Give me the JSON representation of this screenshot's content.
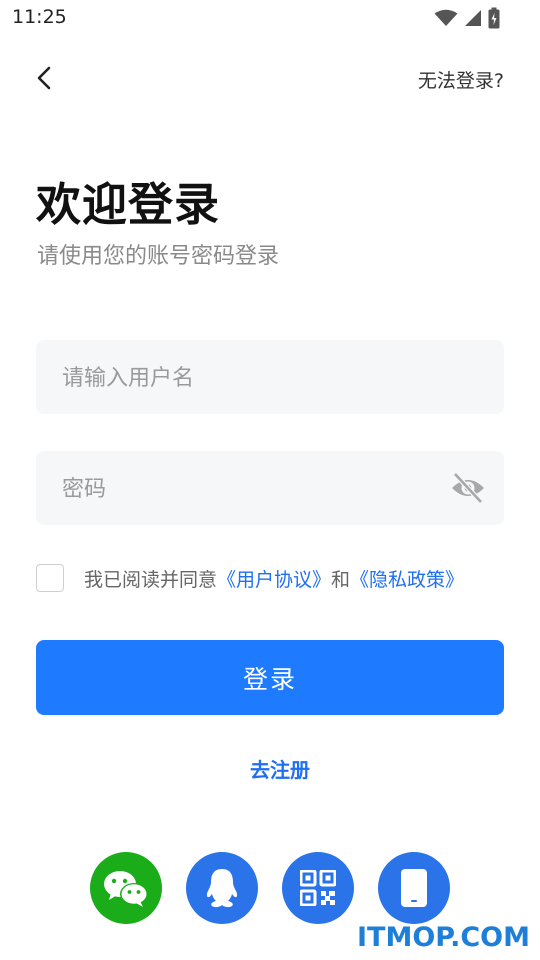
{
  "status_bar": {
    "time": "11:25"
  },
  "header": {
    "back_icon": "chevron-left-icon",
    "help_link": "无法登录?"
  },
  "title": "欢迎登录",
  "subtitle": "请使用您的账号密码登录",
  "form": {
    "username": {
      "placeholder": "请输入用户名",
      "value": ""
    },
    "password": {
      "placeholder": "密码",
      "value": "",
      "toggle_icon": "eye-off-icon"
    }
  },
  "agreement": {
    "checked": false,
    "prefix": "我已阅读并同意",
    "user_agreement": "《用户协议》",
    "conjunction": "和",
    "privacy_policy": "《隐私政策》"
  },
  "login_button": "登录",
  "register_link": "去注册",
  "social_logins": [
    {
      "icon": "wechat-icon",
      "color": "#1aad19"
    },
    {
      "icon": "qq-icon",
      "color": "#2a73e8"
    },
    {
      "icon": "qr-code-icon",
      "color": "#2a73e8"
    },
    {
      "icon": "phone-icon",
      "color": "#2a73e8"
    }
  ],
  "watermark": "ITMOP.COM",
  "colors": {
    "primary": "#1e7bff",
    "link": "#1e6ff2",
    "field_bg": "#f6f7f9"
  }
}
